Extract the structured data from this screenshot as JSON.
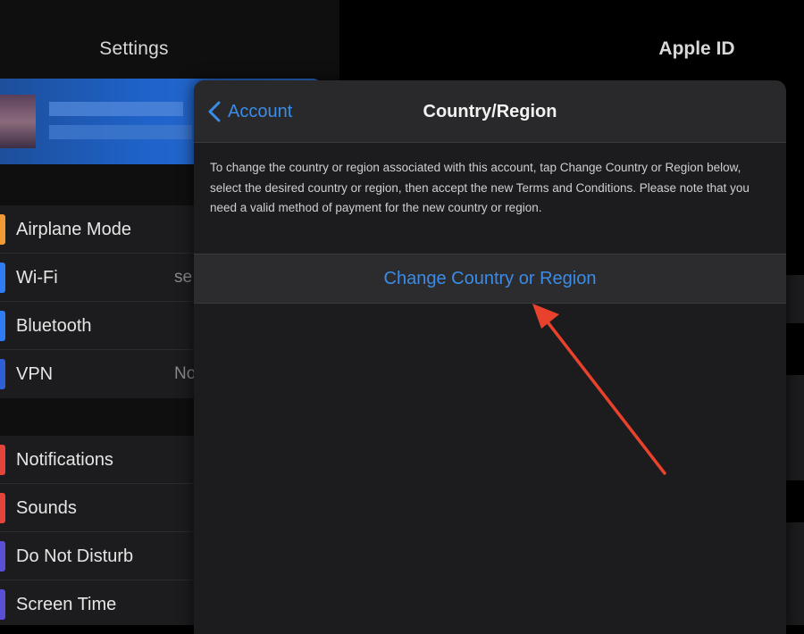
{
  "left_pane": {
    "title": "Settings",
    "group1": [
      {
        "label": "Airplane Mode",
        "value": "",
        "accent": "#f09a36"
      },
      {
        "label": "Wi-Fi",
        "value": "se",
        "accent": "#2f7cf6"
      },
      {
        "label": "Bluetooth",
        "value": "",
        "accent": "#2f7cf6"
      },
      {
        "label": "VPN",
        "value": "No",
        "accent": "#2f5fd6"
      }
    ],
    "group2": [
      {
        "label": "Notifications",
        "value": "",
        "accent": "#e5443a"
      },
      {
        "label": "Sounds",
        "value": "",
        "accent": "#e5443a"
      },
      {
        "label": "Do Not Disturb",
        "value": "",
        "accent": "#5b4fd6"
      },
      {
        "label": "Screen Time",
        "value": "",
        "accent": "#5b4fd6"
      }
    ]
  },
  "right_pane": {
    "title": "Apple ID"
  },
  "sheet": {
    "back_label": "Account",
    "title": "Country/Region",
    "description": "To change the country or region associated with this account, tap Change Country or Region below, select the desired country or region, then accept the new Terms and Conditions. Please note that you need a valid method of payment for the new country or region.",
    "action_label": "Change Country or Region"
  },
  "colors": {
    "accent_blue": "#3b8ce6",
    "annotation_arrow": "#e8412c",
    "sheet_background": "#1c1c1e"
  },
  "icons": {
    "back": "chevron-left-icon",
    "annotation": "red-arrow-icon"
  }
}
